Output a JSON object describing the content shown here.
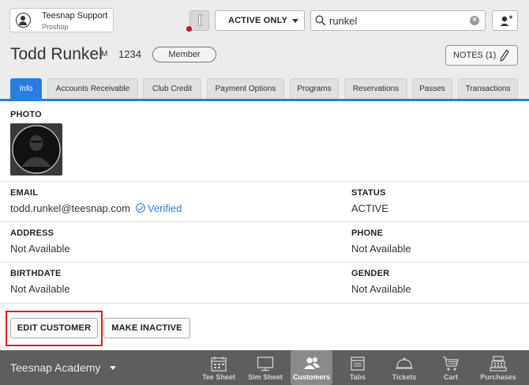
{
  "header": {
    "user_name": "Teesnap Support",
    "user_role": "Proshop",
    "filter_value": "ACTIVE ONLY",
    "search_value": "runkel",
    "clear_glyph": "×"
  },
  "customer": {
    "name": "Todd Runkel",
    "initial": "M",
    "id": "1234",
    "badge": "Member",
    "notes_label": "NOTES (1)"
  },
  "tabs": [
    {
      "label": "Info",
      "active": true
    },
    {
      "label": "Accounts Receivable"
    },
    {
      "label": "Club Credit"
    },
    {
      "label": "Payment Options"
    },
    {
      "label": "Programs"
    },
    {
      "label": "Reservations"
    },
    {
      "label": "Passes"
    },
    {
      "label": "Transactions"
    }
  ],
  "info": {
    "photo_label": "PHOTO",
    "email_label": "EMAIL",
    "email_value": "todd.runkel@teesnap.com",
    "verified_label": "Verified",
    "status_label": "STATUS",
    "status_value": "ACTIVE",
    "address_label": "ADDRESS",
    "address_value": "Not Available",
    "phone_label": "PHONE",
    "phone_value": "Not Available",
    "birthdate_label": "BIRTHDATE",
    "birthdate_value": "Not Available",
    "gender_label": "GENDER",
    "gender_value": "Not Available"
  },
  "actions": {
    "edit_label": "EDIT CUSTOMER",
    "inactive_label": "MAKE INACTIVE"
  },
  "bottom_nav": {
    "location": "Teesnap Academy",
    "items": [
      {
        "label": "Tee Sheet",
        "icon": "calendar-icon"
      },
      {
        "label": "Sim Sheet",
        "icon": "monitor-icon"
      },
      {
        "label": "Customers",
        "icon": "users-icon",
        "active": true
      },
      {
        "label": "Tabs",
        "icon": "tabs-icon"
      },
      {
        "label": "Tickets",
        "icon": "bell-icon"
      },
      {
        "label": "Cart",
        "icon": "cart-icon"
      },
      {
        "label": "Purchases",
        "icon": "register-icon"
      }
    ]
  },
  "colors": {
    "accent": "#2a7de1",
    "highlight": "#e0201a",
    "bottom_bar": "#5e5e5e"
  }
}
